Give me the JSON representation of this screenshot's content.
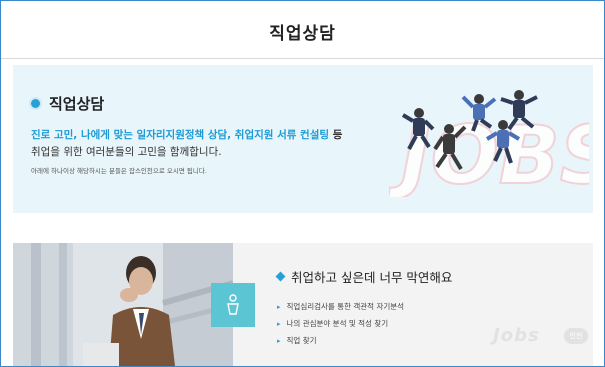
{
  "page": {
    "title": "직업상담"
  },
  "intro": {
    "heading": "직업상담",
    "highlight_text": "진로 고민, 나에게 맞는 일자리지원정책 상담, 취업지원 서류 컨설팅",
    "highlight_suffix": " 등",
    "line2": "취업을 위한 여러분들의 고민을 함께합니다.",
    "note": "아래에 하나이상 해당하시는 분들은 잡스인천으로 오시면 됩니다."
  },
  "illustration": {
    "letters": "JOBS"
  },
  "concern": {
    "heading": "취업하고 싶은데 너무 막연해요",
    "items": [
      "직업심리검사를 통한 객관적 자기분석",
      "나의 관심분야 분석 및 적성 찾기",
      "직업 찾기"
    ],
    "watermark": "Jobs",
    "watermark_badge": "인천"
  },
  "colors": {
    "accent": "#2a9fd6",
    "panel": "#e8f5fa",
    "teal": "#5bc5d3",
    "border": "#3b88c8"
  }
}
